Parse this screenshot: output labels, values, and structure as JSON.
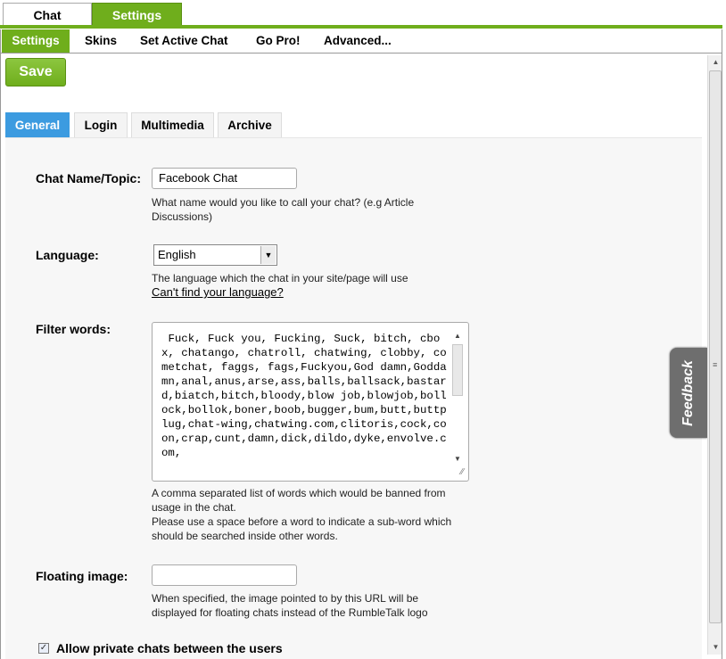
{
  "top_tabs": {
    "chat": "Chat",
    "settings": "Settings"
  },
  "subnav": [
    "Settings",
    "Skins",
    "Set Active Chat",
    "Go Pro!",
    "Advanced..."
  ],
  "save_label": "Save",
  "inner_tabs": [
    "General",
    "Login",
    "Multimedia",
    "Archive"
  ],
  "chat_name": {
    "label": "Chat Name/Topic:",
    "value": "Facebook Chat",
    "help": "What name would you like to call your chat? (e.g Article Discussions)"
  },
  "language": {
    "label": "Language:",
    "value": "English",
    "help": "The language which the chat in your site/page will use",
    "link": "Can't find your language?"
  },
  "filter_words": {
    "label": "Filter words:",
    "value": " Fuck, Fuck you, Fucking, Suck, bitch, cbox, chatango, chatroll, chatwing, clobby, cometchat, faggs, fags,Fuckyou,God damn,Goddamn,anal,anus,arse,ass,balls,ballsack,bastard,biatch,bitch,bloody,blow job,blowjob,bollock,bollok,boner,boob,bugger,bum,butt,buttplug,chat-wing,chatwing.com,clitoris,cock,coon,crap,cunt,damn,dick,dildo,dyke,envolve.com,",
    "help1": "A comma separated list of words which would be banned from usage in the chat.",
    "help2": "Please use a space before a word to indicate a sub-word which should be searched inside other words."
  },
  "floating_image": {
    "label": "Floating image:",
    "value": "",
    "help": "When specified, the image pointed to by this URL will be displayed for floating chats instead of the RumbleTalk logo"
  },
  "private_chats": {
    "label": "Allow private chats between the users",
    "checked": true
  },
  "feedback_label": "Feedback",
  "icons": {
    "select_arrow": "chevron-down-icon",
    "checkbox": "check-icon"
  },
  "colors": {
    "accent_green": "#6fae1c",
    "active_blue": "#3c9be0",
    "feedback_gray": "#6e6e6e"
  }
}
